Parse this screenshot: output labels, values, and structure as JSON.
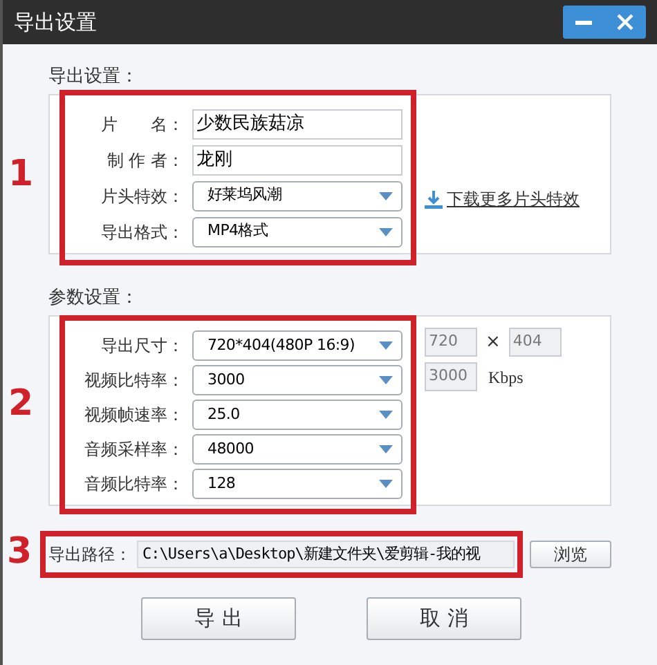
{
  "window": {
    "title": "导出设置"
  },
  "export_settings": {
    "heading": "导出设置：",
    "annotation": "1",
    "fields": [
      {
        "kind": "text",
        "label": "片　　名：",
        "value": "少数民族菇凉"
      },
      {
        "kind": "text",
        "label": "制 作 者：",
        "value": "龙刚"
      },
      {
        "kind": "dropdown",
        "label": "片头特效：",
        "value": "好莱坞风潮"
      },
      {
        "kind": "dropdown",
        "label": "导出格式：",
        "value": "MP4格式"
      }
    ],
    "link": "下载更多片头特效"
  },
  "parameter_settings": {
    "heading": "参数设置：",
    "annotation": "2",
    "fields": [
      {
        "label": "导出尺寸：",
        "value": "720*404(480P 16:9)"
      },
      {
        "label": "视频比特率：",
        "value": "3000"
      },
      {
        "label": "视频帧速率：",
        "value": "25.0"
      },
      {
        "label": "音频采样率：",
        "value": "48000"
      },
      {
        "label": "音频比特率：",
        "value": "128"
      }
    ],
    "width": {
      "value": "720",
      "disabled": true
    },
    "times": "×",
    "height": {
      "value": "404",
      "disabled": true
    },
    "bitrate": {
      "value": "3000",
      "disabled": true
    },
    "bitrate_unit": "Kbps"
  },
  "export_path": {
    "annotation": "3",
    "label": "导出路径：",
    "value": "C:\\Users\\a\\Desktop\\新建文件夹\\爱剪辑-我的视",
    "browse": "浏览"
  },
  "buttons": [
    "导 出",
    "取 消"
  ]
}
